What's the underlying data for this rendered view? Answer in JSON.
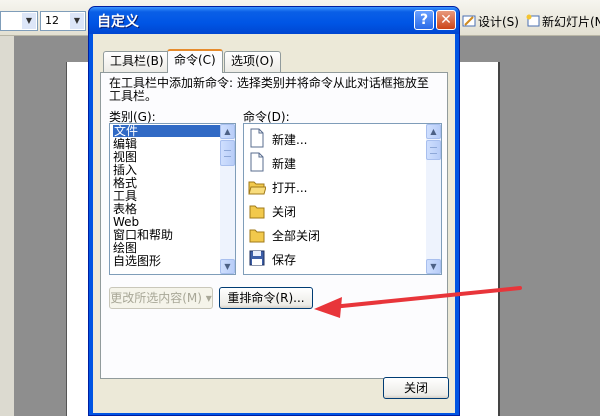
{
  "app": {
    "font_size_value": "12",
    "design_label": "设计(S)",
    "new_slide_label": "新幻灯片(N)"
  },
  "dialog": {
    "title": "自定义",
    "help_glyph": "?",
    "close_glyph": "✕",
    "tabs": [
      {
        "label": "工具栏(B)",
        "active": false
      },
      {
        "label": "命令(C)",
        "active": true
      },
      {
        "label": "选项(O)",
        "active": false
      }
    ],
    "instructions": "在工具栏中添加新命令: 选择类别并将命令从此对话框拖放至工具栏。",
    "categories_label": "类别(G):",
    "commands_label": "命令(D):",
    "categories": [
      "文件",
      "编辑",
      "视图",
      "插入",
      "格式",
      "工具",
      "表格",
      "Web",
      "窗口和帮助",
      "绘图",
      "自选图形"
    ],
    "selected_category": "文件",
    "commands": [
      {
        "label": "新建...",
        "icon": "new-document-icon"
      },
      {
        "label": "新建",
        "icon": "new-document-icon"
      },
      {
        "label": "打开...",
        "icon": "open-folder-icon"
      },
      {
        "label": "关闭",
        "icon": "folder-icon"
      },
      {
        "label": "全部关闭",
        "icon": "folder-icon"
      },
      {
        "label": "保存",
        "icon": "save-floppy-icon"
      }
    ],
    "modify_selection_label": "更改所选内容(M)",
    "rearrange_label": "重排命令(R)...",
    "close_label": "关闭"
  },
  "colors": {
    "title_bar": "#0055e5",
    "selection": "#316ac5",
    "annotation_arrow": "#e8353a"
  }
}
